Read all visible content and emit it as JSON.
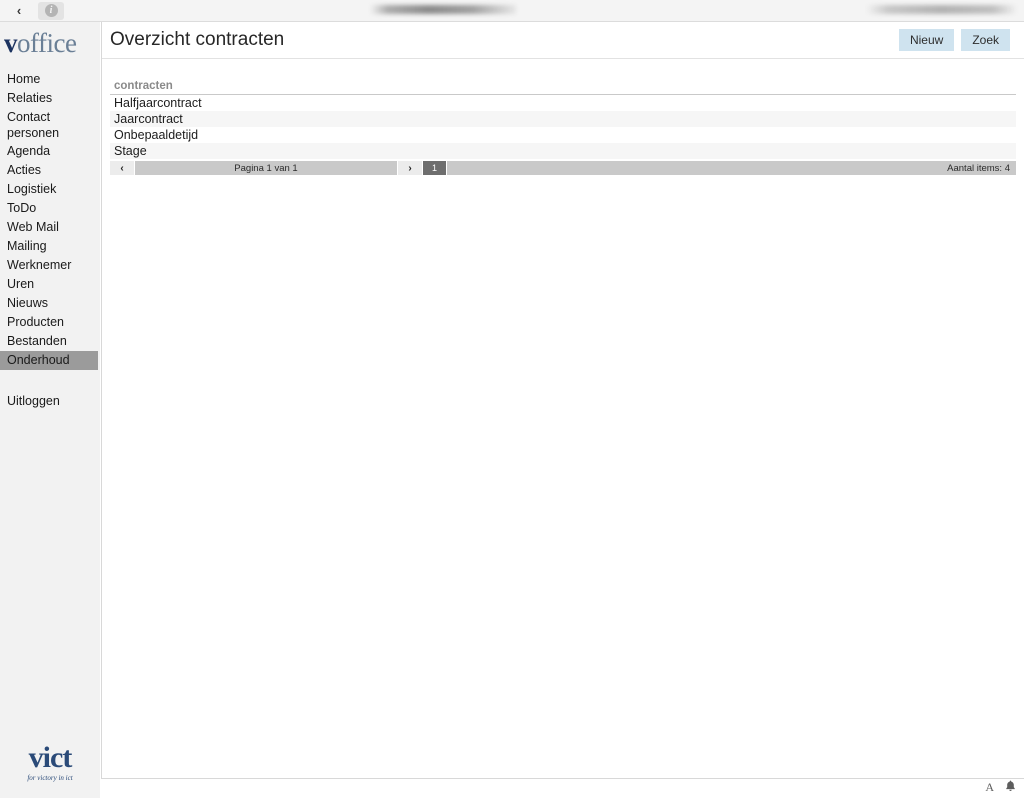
{
  "browser_chrome": {
    "back_icon": "chevron-left-icon",
    "info_icon": "info-icon",
    "info_glyph": "i",
    "back_glyph": "‹",
    "address_text_redacted": "",
    "right_text_redacted": ""
  },
  "sidebar": {
    "logo": {
      "part_bold": "v",
      "part_light": "office"
    },
    "items": [
      {
        "label": "Home",
        "selected": false
      },
      {
        "label": "Relaties",
        "selected": false
      },
      {
        "label": "Contact personen",
        "selected": false
      },
      {
        "label": "Agenda",
        "selected": false
      },
      {
        "label": "Acties",
        "selected": false
      },
      {
        "label": "Logistiek",
        "selected": false
      },
      {
        "label": "ToDo",
        "selected": false
      },
      {
        "label": "Web Mail",
        "selected": false
      },
      {
        "label": "Mailing",
        "selected": false
      },
      {
        "label": "Werknemer",
        "selected": false
      },
      {
        "label": "Uren",
        "selected": false
      },
      {
        "label": "Nieuws",
        "selected": false
      },
      {
        "label": "Producten",
        "selected": false
      },
      {
        "label": "Bestanden",
        "selected": false
      },
      {
        "label": "Onderhoud",
        "selected": true
      }
    ],
    "logout_label": "Uitloggen",
    "footer_logo": {
      "text": "vict",
      "tagline": "for victory in ict"
    }
  },
  "header": {
    "title": "Overzicht contracten",
    "buttons": [
      {
        "label": "Nieuw",
        "name": "new-button"
      },
      {
        "label": "Zoek",
        "name": "search-button"
      }
    ]
  },
  "table": {
    "columns": [
      "contracten"
    ],
    "rows": [
      [
        "Halfjaarcontract"
      ],
      [
        "Jaarcontract"
      ],
      [
        "Onbepaaldetijd"
      ],
      [
        "Stage"
      ]
    ]
  },
  "pagination": {
    "prev_glyph": "‹",
    "next_glyph": "›",
    "page_label": "Pagina 1 van 1",
    "current_page": "1",
    "count_label": "Aantal items: 4"
  },
  "status_bar": {
    "text_size_glyph": "A",
    "bell_glyph": "🔔"
  },
  "colors": {
    "accent_button": "#cfe3ef",
    "selected_nav": "#9b9b9b",
    "logo_dark": "#1d3461",
    "logo_light": "#6a7f96",
    "row_alt": "#f6f6f6"
  }
}
